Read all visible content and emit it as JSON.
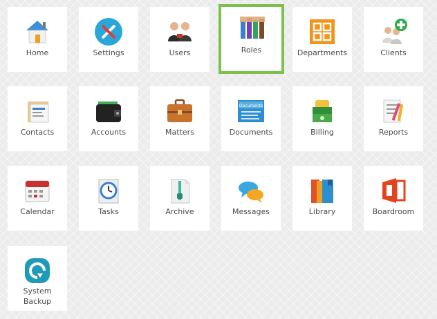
{
  "tiles": [
    {
      "label": "Home",
      "icon": "home-icon"
    },
    {
      "label": "Settings",
      "icon": "settings-icon"
    },
    {
      "label": "Users",
      "icon": "users-icon"
    },
    {
      "label": "Roles",
      "icon": "roles-icon",
      "selected": true
    },
    {
      "label": "Departments",
      "icon": "departments-icon"
    },
    {
      "label": "Clients",
      "icon": "clients-icon"
    },
    {
      "label": "Contacts",
      "icon": "contacts-icon"
    },
    {
      "label": "Accounts",
      "icon": "accounts-icon"
    },
    {
      "label": "Matters",
      "icon": "matters-icon"
    },
    {
      "label": "Documents",
      "icon": "documents-icon",
      "icon_text": "Documents"
    },
    {
      "label": "Billing",
      "icon": "billing-icon"
    },
    {
      "label": "Reports",
      "icon": "reports-icon"
    },
    {
      "label": "Calendar",
      "icon": "calendar-icon"
    },
    {
      "label": "Tasks",
      "icon": "tasks-icon"
    },
    {
      "label": "Archive",
      "icon": "archive-icon"
    },
    {
      "label": "Messages",
      "icon": "messages-icon"
    },
    {
      "label": "Library",
      "icon": "library-icon"
    },
    {
      "label": "Boardroom",
      "icon": "boardroom-icon"
    },
    {
      "label_line1": "System",
      "label_line2": "Backup",
      "icon": "system-backup-icon"
    }
  ],
  "colors": {
    "selected_border": "#7cc14d",
    "tile_bg": "#ffffff",
    "page_bg": "#ececec"
  }
}
